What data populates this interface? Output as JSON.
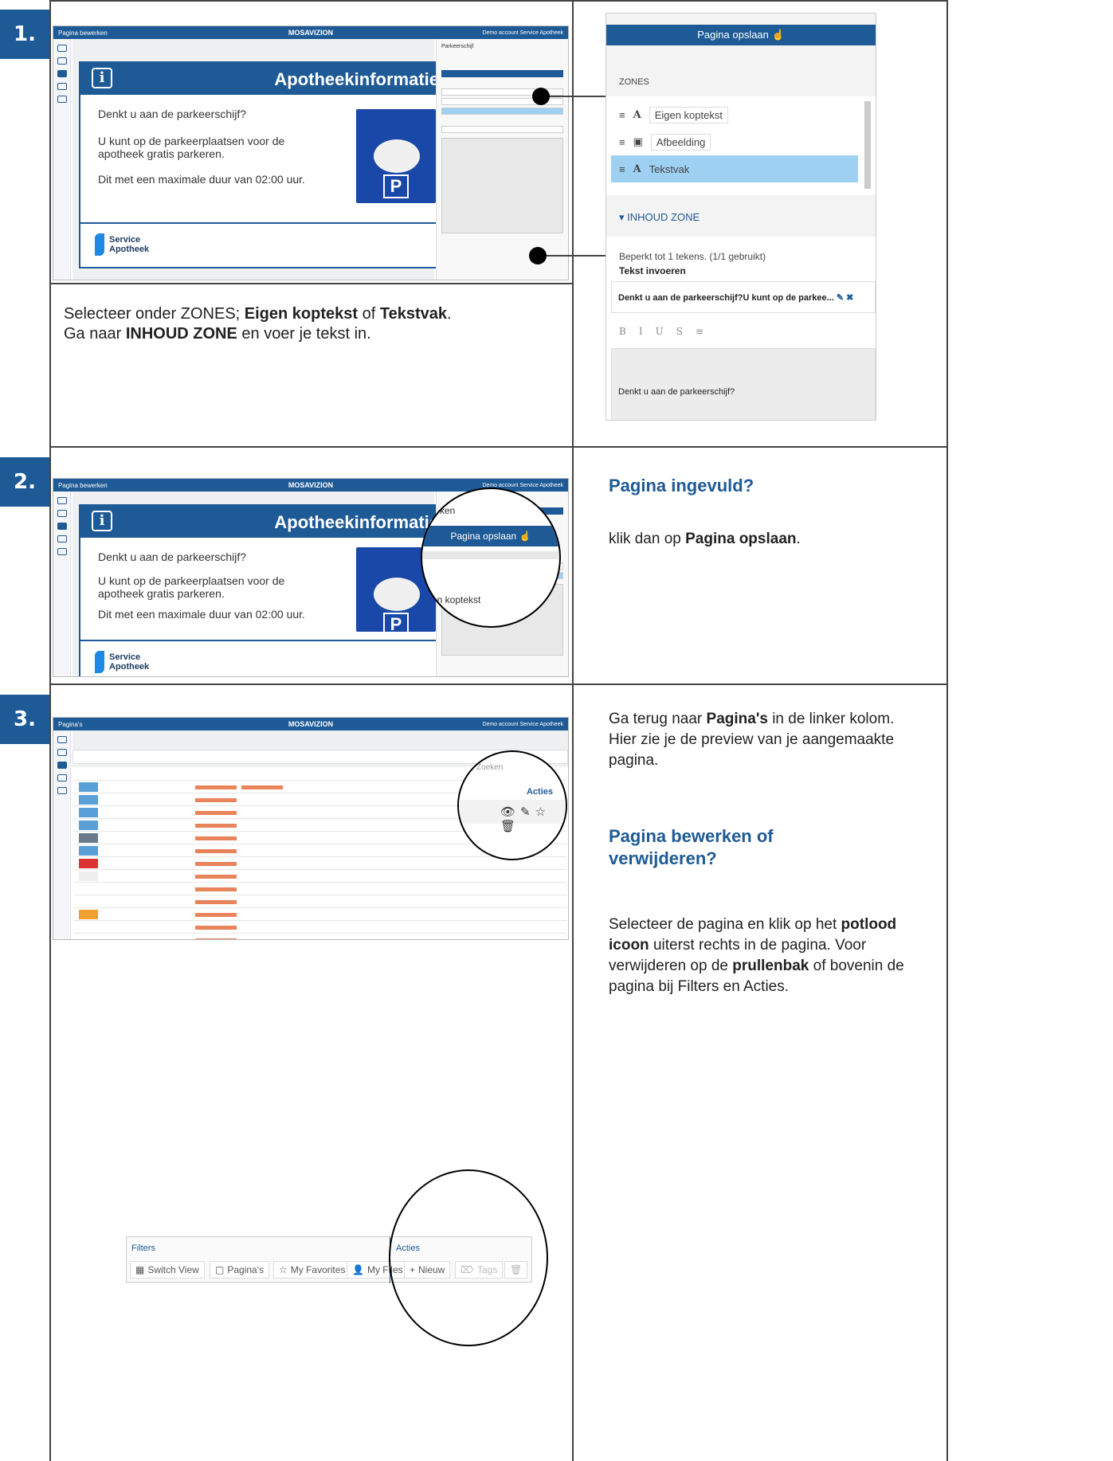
{
  "step1": {
    "number": "1.",
    "window_title": "Pagina bewerken",
    "brand": "MOSAVIZION",
    "account": "Demo account Service Apotheek",
    "slide_title": "Apotheekinformatie",
    "slide_lines": [
      "Denkt u aan de parkeerschijf?",
      "U kunt op de parkeerplaatsen voor de apotheek gratis parkeren.",
      "Dit met een maximale duur van 02:00 uur."
    ],
    "logo": [
      "Service",
      "Apotheek"
    ],
    "caption_parts": [
      "Selecteer onder ZONES; ",
      "Eigen koptekst",
      " of ",
      "Tekstvak",
      ".",
      "Ga naar ",
      "INHOUD ZONE",
      " en voer je tekst in."
    ],
    "zoom": {
      "save_label": "Pagina opslaan",
      "zones_label": "ZONES",
      "zones": [
        "Eigen koptekst",
        "Afbeelding",
        "Tekstvak"
      ],
      "inhoud_label": "INHOUD ZONE",
      "limit": "Beperkt tot 1 tekens. (1/1 gebruikt)",
      "tekst_label": "Tekst invoeren",
      "input_value": "Denkt u aan de parkeerschijf?U kunt op de parkee...",
      "format_buttons": [
        "B",
        "I",
        "U",
        "S",
        "≡"
      ],
      "preview_text": "Denkt u aan de parkeerschijf?"
    },
    "panel_title": "Parkeerschijf"
  },
  "step2": {
    "number": "2.",
    "window_title": "Pagina bewerken",
    "heading": "Pagina ingevuld?",
    "text_parts": [
      "klik dan op ",
      "Pagina opslaan",
      "."
    ],
    "zoom_save": "Pagina opslaan",
    "zoom_side": "rken",
    "zoom_kop": "en koptekst"
  },
  "step3": {
    "number": "3.",
    "window_title": "Pagina's",
    "intro_parts": [
      "Ga terug naar ",
      "Pagina's",
      " in de linker kolom.",
      "Hier zie je de preview van je aangemaakte pagina."
    ],
    "heading": "Pagina bewerken of verwijderen?",
    "text_parts": [
      "Selecteer de pagina en klik op het ",
      "potlood icoon",
      " uiterst rechts in de pagina. Voor verwijderen op de ",
      "prullenbak",
      " of bovenin de pagina bij Filters en Acties."
    ],
    "circle_acties": "Acties",
    "circle_zoeken": "Zoeken",
    "filters": {
      "label": "Filters",
      "buttons": [
        "Switch View",
        "Pagina's",
        "My Favorites",
        "My Files"
      ],
      "acties_label": "Acties",
      "acties_buttons": [
        "Nieuw",
        "Tags"
      ]
    }
  },
  "colors": {
    "primary": "#1e5a96",
    "selection": "#9ed0f2",
    "tag": "#e8835a"
  }
}
